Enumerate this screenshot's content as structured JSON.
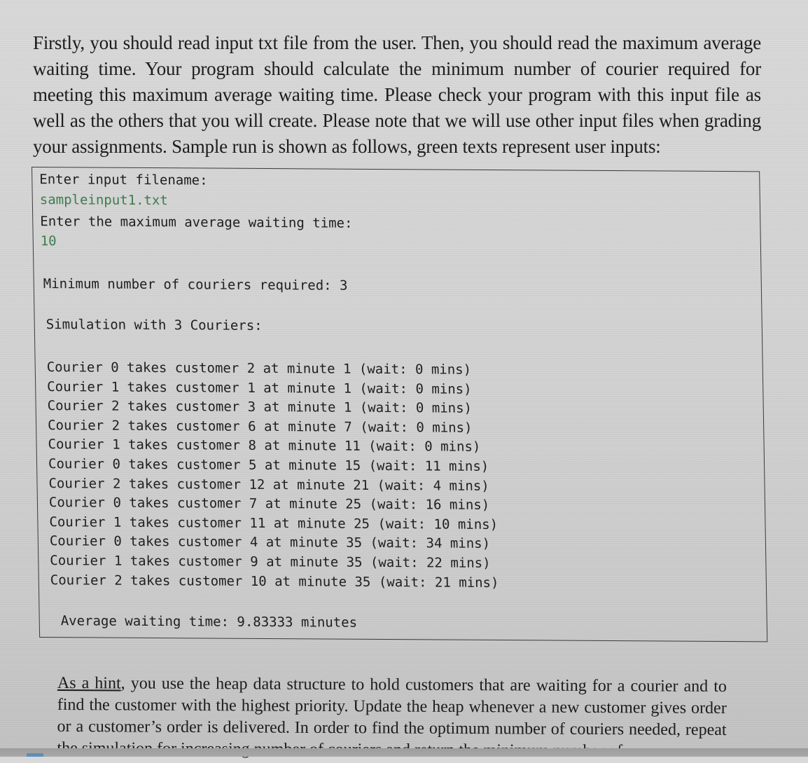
{
  "intro_paragraph": "Firstly, you should read input txt file from the user. Then, you should read the maximum average waiting time. Your program should calculate the minimum number of courier required for meeting this maximum average waiting time. Please check your program with this input file as well as the others that you will create. Please note that we will use other input files when grading your assignments. Sample run is shown as follows, green texts represent user inputs:",
  "console": {
    "prompt_filename": "Enter input filename:",
    "input_filename": "sampleinput1.txt",
    "prompt_max_wait": "Enter the maximum average waiting time:",
    "input_max_wait": "10",
    "min_couriers_line": "Minimum number of couriers required: 3",
    "simulation_header": "Simulation with 3 Couriers:",
    "log": [
      "Courier 0 takes customer 2 at minute 1 (wait: 0 mins)",
      "Courier 1 takes customer 1 at minute 1 (wait: 0 mins)",
      "Courier 2 takes customer 3 at minute 1 (wait: 0 mins)",
      "Courier 2 takes customer 6 at minute 7 (wait: 0 mins)",
      "Courier 1 takes customer 8 at minute 11 (wait: 0 mins)",
      "Courier 0 takes customer 5 at minute 15 (wait: 11 mins)",
      "Courier 2 takes customer 12 at minute 21 (wait: 4 mins)",
      "Courier 0 takes customer 7 at minute 25 (wait: 16 mins)",
      "Courier 1 takes customer 11 at minute 25 (wait: 10 mins)",
      "Courier 0 takes customer 4 at minute 35 (wait: 34 mins)",
      "Courier 1 takes customer 9 at minute 35 (wait: 22 mins)",
      "Courier 2 takes customer 10 at minute 35 (wait: 21 mins)"
    ],
    "average_line": "Average waiting time: 9.83333 minutes"
  },
  "hint": {
    "underlined": "As a hint",
    "rest": ", you use the heap data structure to hold customers that are waiting for a courier and to find the customer with the highest priority. Update the heap whenever a new customer gives order or a customer’s order is delivered. In order to find the optimum number of couriers needed, repeat the simulation for increasing number of couriers and return the minimum number of"
  },
  "colors": {
    "user_input_green": "#3a7d4e",
    "text": "#1c1c1c"
  }
}
